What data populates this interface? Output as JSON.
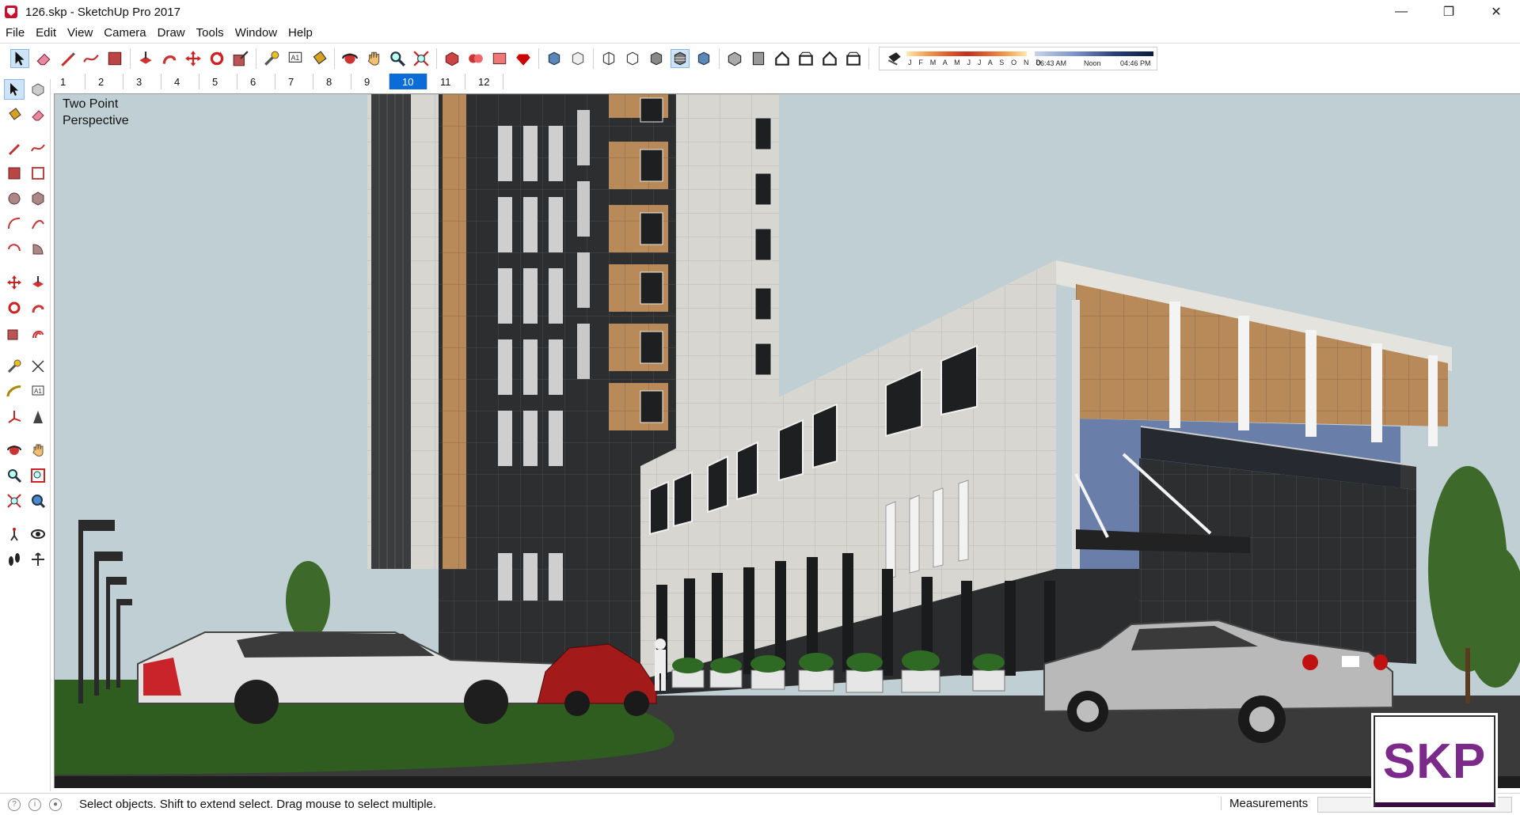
{
  "window": {
    "title": "126.skp - SketchUp Pro 2017",
    "controls": {
      "minimize": "—",
      "maximize": "❐",
      "close": "✕"
    }
  },
  "menu": [
    "File",
    "Edit",
    "View",
    "Camera",
    "Draw",
    "Tools",
    "Window",
    "Help"
  ],
  "toolbar": {
    "tools": [
      "select-arrow",
      "eraser",
      "pencil-line",
      "freehand",
      "rectangle",
      "push-pull",
      "follow-me",
      "move",
      "rotate",
      "scale",
      "tape-measure",
      "text",
      "paint-bucket",
      "orbit",
      "pan",
      "zoom",
      "zoom-extents",
      "components",
      "3d-warehouse",
      "extension-warehouse",
      "ruby",
      "xray",
      "back-edges",
      "wireframe",
      "hidden-line",
      "shaded",
      "shaded-textures",
      "monochrome",
      "iso",
      "top",
      "front",
      "right",
      "back",
      "left",
      "shadows"
    ],
    "shadow_months": "J F M A M J J A S O N D",
    "shadow_time_start": "06:43 AM",
    "shadow_time_mid": "Noon",
    "shadow_time_end": "04:46 PM"
  },
  "scenes": {
    "tabs": [
      "1",
      "2",
      "3",
      "4",
      "5",
      "6",
      "7",
      "8",
      "9",
      "10",
      "11",
      "12"
    ],
    "selected": "10"
  },
  "viewport": {
    "camera_label_line1": "Two Point",
    "camera_label_line2": "Perspective",
    "sky_color": "#bfcfd3",
    "ground_color": "#3a3a3a",
    "lawn_color": "#2f5d1f"
  },
  "status": {
    "hint": "Select objects. Shift to extend select. Drag mouse to select multiple.",
    "measurements_label": "Measurements",
    "measurements_value": ""
  },
  "badge": {
    "text": "SKP",
    "color": "#7b2a8a"
  }
}
